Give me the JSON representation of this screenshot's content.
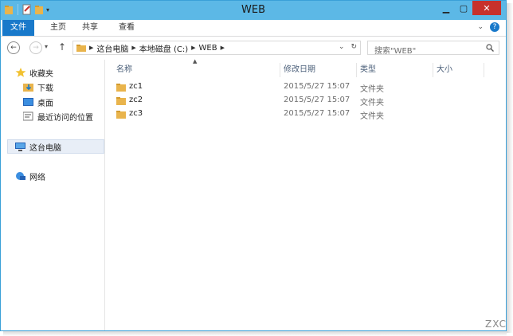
{
  "window": {
    "title": "WEB"
  },
  "ribbon": {
    "tabs": [
      "文件",
      "主页",
      "共享",
      "查看"
    ]
  },
  "address": {
    "crumbs": [
      "这台电脑",
      "本地磁盘 (C:)",
      "WEB"
    ],
    "search_placeholder": "搜索\"WEB\""
  },
  "nav": {
    "favorites": "收藏夹",
    "downloads": "下载",
    "desktop": "桌面",
    "recent": "最近访问的位置",
    "this_pc": "这台电脑",
    "network": "网络"
  },
  "columns": {
    "name": "名称",
    "date": "修改日期",
    "type": "类型",
    "size": "大小"
  },
  "files": [
    {
      "name": "zc1",
      "date": "2015/5/27 15:07",
      "type": "文件夹"
    },
    {
      "name": "zc2",
      "date": "2015/5/27 15:07",
      "type": "文件夹"
    },
    {
      "name": "zc3",
      "date": "2015/5/27 15:07",
      "type": "文件夹"
    }
  ],
  "watermark": "ZXC",
  "colors": {
    "titlebar": "#5cb8e6",
    "file_tab": "#1979ca",
    "close": "#c7312b",
    "folder": "#e9b44c"
  }
}
